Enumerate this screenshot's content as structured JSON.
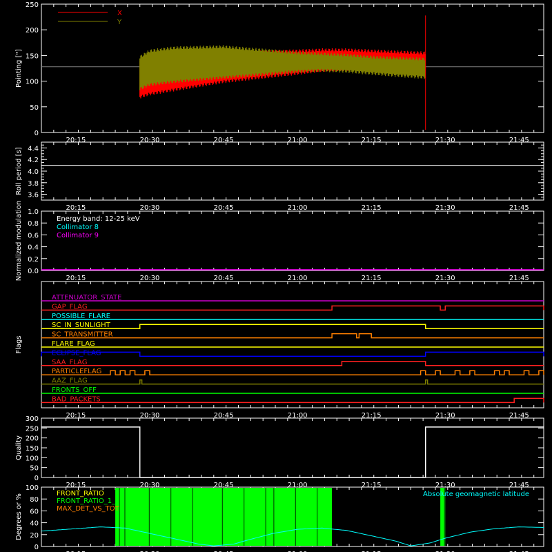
{
  "colors": {
    "background": "#000000",
    "axes": "#ffffff",
    "red": "#ff0000",
    "olive": "#808000",
    "cyan": "#00ffff",
    "magenta": "#ff00ff",
    "green": "#00ff00",
    "orange": "#ff8000",
    "yellow": "#ffff00",
    "blue": "#0000ff",
    "purple": "#cc00cc",
    "white": "#ffffff"
  },
  "chart_data": [
    {
      "id": "pointing",
      "type": "line",
      "xlabel": "",
      "ylabel": "Pointing [\"]",
      "x_ticks": [
        "20:15",
        "20:30",
        "20:45",
        "21:00",
        "21:15",
        "21:30",
        "21:45"
      ],
      "ylim": [
        0,
        250
      ],
      "y_ticks": [
        "0",
        "50",
        "100",
        "150",
        "200",
        "250"
      ],
      "legend": {
        "placement": "top-left",
        "entries": [
          {
            "name": "X",
            "color": "#ff0000"
          },
          {
            "name": "Y",
            "color": "#808000"
          }
        ]
      },
      "x_range": [
        "20:08",
        "21:50"
      ],
      "reference_line": {
        "y": 128,
        "color": "#808080"
      },
      "series": [
        {
          "name": "X",
          "color": "#ff0000",
          "start": "20:28",
          "end": "21:26",
          "envelope": {
            "x": [
              "20:28",
              "20:30",
              "20:35",
              "20:45",
              "21:00",
              "21:05",
              "21:10",
              "21:15",
              "21:20",
              "21:26"
            ],
            "upper": [
              142,
              146,
              152,
              158,
              162,
              164,
              164,
              162,
              160,
              158
            ],
            "lower": [
              66,
              72,
              80,
              96,
              112,
              118,
              120,
              122,
              122,
              118
            ]
          }
        },
        {
          "name": "Y",
          "color": "#808000",
          "start": "20:28",
          "end": "21:26",
          "envelope": {
            "x": [
              "20:28",
              "20:30",
              "20:35",
              "20:45",
              "21:00",
              "21:05",
              "21:10",
              "21:15",
              "21:20",
              "21:26"
            ],
            "upper": [
              150,
              162,
              168,
              170,
              158,
              156,
              154,
              150,
              148,
              146
            ],
            "lower": [
              82,
              90,
              96,
              104,
              116,
              118,
              116,
              112,
              108,
              104
            ]
          }
        }
      ],
      "spike": {
        "x": "21:26",
        "y_min": 5,
        "y_max": 228
      }
    },
    {
      "id": "roll",
      "type": "line",
      "xlabel": "",
      "ylabel": "Roll period [s]",
      "x_ticks": [
        "20:15",
        "20:30",
        "20:45",
        "21:00",
        "21:15",
        "21:30",
        "21:45"
      ],
      "ylim": [
        3.5,
        4.5
      ],
      "y_ticks": [
        "3.6",
        "3.8",
        "4.0",
        "4.2",
        "4.4"
      ],
      "x_range": [
        "20:08",
        "21:50"
      ],
      "series": [
        {
          "name": "",
          "color": "#ffffff",
          "x": [
            "20:08",
            "21:50"
          ],
          "y": [
            4.1,
            4.1
          ]
        }
      ]
    },
    {
      "id": "modulation",
      "type": "line",
      "xlabel": "",
      "ylabel": "Normalized modulation",
      "x_ticks": [
        "20:15",
        "20:30",
        "20:45",
        "21:00",
        "21:15",
        "21:30",
        "21:45"
      ],
      "ylim": [
        0,
        1.0
      ],
      "y_ticks": [
        "0.0",
        "0.2",
        "0.4",
        "0.6",
        "0.8",
        "1.0"
      ],
      "x_range": [
        "20:08",
        "21:50"
      ],
      "annotations": [
        {
          "text": "Energy band: 12-25 keV",
          "color": "#ffffff"
        },
        {
          "text": "Collimator 8",
          "color": "#00ffff"
        },
        {
          "text": "Collimator 9",
          "color": "#ff00ff"
        }
      ],
      "series": [
        {
          "name": "",
          "color": "#ff00ff",
          "x": [
            "20:08",
            "21:50"
          ],
          "y": [
            0,
            0
          ]
        }
      ]
    },
    {
      "id": "flags",
      "type": "line",
      "xlabel": "",
      "ylabel": "Flags",
      "x_ticks": [
        "20:15",
        "20:30",
        "20:45",
        "21:00",
        "21:15",
        "21:30",
        "21:45"
      ],
      "x_range": [
        "20:08",
        "21:50"
      ],
      "flags": [
        {
          "name": "ATTENUATOR_STATE",
          "color": "#cc00cc",
          "segments": []
        },
        {
          "name": "GAP_FLAG",
          "color": "#ff2020",
          "segments": [
            [
              "21:07",
              "21:29"
            ],
            [
              "21:30",
              "21:50"
            ]
          ]
        },
        {
          "name": "POSSIBLE_FLARE",
          "color": "#00ffff",
          "segments": []
        },
        {
          "name": "SC_IN_SUNLIGHT",
          "color": "#ffff00",
          "segments": [
            [
              "20:28",
              "21:26"
            ]
          ]
        },
        {
          "name": "SC_TRANSMITTER",
          "color": "#ff8000",
          "segments": [
            [
              "21:07",
              "21:12"
            ],
            [
              "21:12.5",
              "21:15"
            ]
          ]
        },
        {
          "name": "FLARE_FLAG",
          "color": "#ffff00",
          "segments": []
        },
        {
          "name": "ECLIPSE_FLAG",
          "color": "#0000ff",
          "segments": [
            [
              "20:08",
              "20:28"
            ],
            [
              "21:26",
              "21:50"
            ]
          ]
        },
        {
          "name": "SAA_FLAG",
          "color": "#ff2020",
          "segments": [
            [
              "21:09",
              "21:26"
            ]
          ]
        },
        {
          "name": "PARTICLEFLAG",
          "color": "#ff8000",
          "segments": [
            [
              "20:22",
              "20:23"
            ],
            [
              "20:24",
              "20:25"
            ],
            [
              "20:26",
              "20:27"
            ],
            [
              "20:29",
              "20:30"
            ],
            [
              "21:25",
              "21:26"
            ],
            [
              "21:28",
              "21:29"
            ],
            [
              "21:32",
              "21:33"
            ],
            [
              "21:35",
              "21:36"
            ],
            [
              "21:40",
              "21:41"
            ],
            [
              "21:42",
              "21:43"
            ],
            [
              "21:46",
              "21:47"
            ],
            [
              "21:49",
              "21:50"
            ]
          ]
        },
        {
          "name": "AAZ_FLAG",
          "color": "#808000",
          "segments": [
            [
              "20:28",
              "20:28.4"
            ],
            [
              "21:26",
              "21:26.4"
            ]
          ]
        },
        {
          "name": "FRONTS_OFF",
          "color": "#00ff00",
          "segments": []
        },
        {
          "name": "BAD_PACKETS",
          "color": "#ff2020",
          "segments": [
            [
              "21:44",
              "21:50"
            ]
          ]
        }
      ]
    },
    {
      "id": "quality",
      "type": "line",
      "xlabel": "",
      "ylabel": "Quality",
      "x_ticks": [
        "20:15",
        "20:30",
        "20:45",
        "21:00",
        "21:15",
        "21:30",
        "21:45"
      ],
      "ylim": [
        0,
        300
      ],
      "y_ticks": [
        "0",
        "50",
        "100",
        "150",
        "200",
        "250",
        "300"
      ],
      "x_range": [
        "20:08",
        "21:50"
      ],
      "series": [
        {
          "name": "",
          "color": "#ffffff",
          "x": [
            "20:08",
            "20:28",
            "20:28",
            "21:26",
            "21:26",
            "21:50"
          ],
          "y": [
            255,
            255,
            0,
            0,
            255,
            255
          ]
        }
      ]
    },
    {
      "id": "ratio",
      "type": "line",
      "xlabel": "",
      "ylabel": "Degrees or %",
      "x_ticks": [
        "20:15",
        "20:30",
        "20:45",
        "21:00",
        "21:15",
        "21:30",
        "21:45"
      ],
      "ylim": [
        0,
        100
      ],
      "y_ticks": [
        "0",
        "20",
        "40",
        "60",
        "80",
        "100"
      ],
      "x_range": [
        "20:08",
        "21:50"
      ],
      "legend": {
        "placement": "top-left",
        "entries": [
          {
            "name": "FRONT_RATIO",
            "color": "#ffff00"
          },
          {
            "name": "FRONT_RATIO_1_2",
            "color": "#00ff00"
          },
          {
            "name": "MAX_DET_VS_TOT",
            "color": "#ff8000"
          }
        ]
      },
      "annotation": {
        "text": "Absolute geomagnetic latitude",
        "color": "#00ffff",
        "placement": "top-right"
      },
      "green_band": [
        [
          "20:23",
          "21:07"
        ],
        [
          "21:29",
          "21:30"
        ]
      ],
      "series": [
        {
          "name": "Absolute geomagnetic latitude",
          "color": "#00ffff",
          "x": [
            "20:08",
            "20:15",
            "20:20",
            "20:25",
            "20:30",
            "20:35",
            "20:40",
            "20:43",
            "20:47",
            "20:50",
            "20:55",
            "21:00",
            "21:05",
            "21:10",
            "21:15",
            "21:20",
            "21:23",
            "21:27",
            "21:30",
            "21:35",
            "21:40",
            "21:45",
            "21:50"
          ],
          "y": [
            26,
            30,
            33,
            31,
            22,
            13,
            4,
            1,
            4,
            11,
            22,
            29,
            31,
            27,
            18,
            9,
            1,
            6,
            14,
            24,
            30,
            33,
            32
          ]
        }
      ]
    }
  ]
}
